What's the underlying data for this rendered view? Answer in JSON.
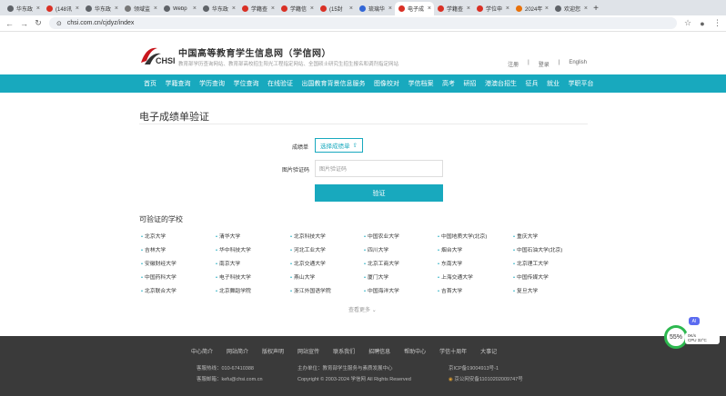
{
  "browser": {
    "tabs": [
      {
        "label": "华东政",
        "color": "#5f6368"
      },
      {
        "label": "(148讯",
        "color": "#d93025"
      },
      {
        "label": "华东政",
        "color": "#5f6368"
      },
      {
        "label": "领域监",
        "color": "#777777"
      },
      {
        "label": "Webp",
        "color": "#5f6368"
      },
      {
        "label": "华东政",
        "color": "#5f6368"
      },
      {
        "label": "学籍查",
        "color": "#d93025"
      },
      {
        "label": "学籍信",
        "color": "#d93025"
      },
      {
        "label": "(15封",
        "color": "#d93025"
      },
      {
        "label": "琉璃华",
        "color": "#3367d6"
      },
      {
        "label": "电子成",
        "color": "#d93025"
      },
      {
        "label": "学籍查",
        "color": "#d93025"
      },
      {
        "label": "学位申",
        "color": "#d93025"
      },
      {
        "label": "2024年",
        "color": "#e8710a"
      },
      {
        "label": "欢迎您",
        "color": "#5f6368"
      }
    ],
    "active_tab": 10,
    "url": "chsi.com.cn/cjdyz/index"
  },
  "header": {
    "site_title": "中国高等教育学生信息网（学信网）",
    "site_subtitle": "教育部学历查询网站、教育部高校招生阳光工程指定网站、全国硕士研究生招生报名和调剂指定网站",
    "logo_text": "CHSI",
    "top_links": [
      "注册",
      "登录",
      "English"
    ]
  },
  "nav": [
    "首页",
    "学籍查询",
    "学历查询",
    "学位查询",
    "在线验证",
    "出国教育背景信息服务",
    "图像校对",
    "学信档案",
    "高考",
    "研招",
    "港澳台招生",
    "征兵",
    "就业",
    "学职平台"
  ],
  "page": {
    "title": "电子成绩单验证",
    "transcript_label": "成绩单",
    "upload_label": "选择成绩单",
    "captcha_label": "图片验证码",
    "captcha_placeholder": "图片验证码",
    "verify_label": "验证",
    "schools_title": "可验证的学校",
    "more_label": "查看更多"
  },
  "schools": [
    [
      "北京大学",
      "清华大学",
      "北京科技大学",
      "中国农业大学",
      "中国地质大学(北京)",
      "重庆大学"
    ],
    [
      "吉林大学",
      "华中科技大学",
      "河北工业大学",
      "四川大学",
      "烟台大学",
      "中国石油大学(北京)"
    ],
    [
      "安徽财经大学",
      "南京大学",
      "北京交通大学",
      "北京工商大学",
      "东南大学",
      "北京理工大学"
    ],
    [
      "中国药科大学",
      "电子科技大学",
      "燕山大学",
      "厦门大学",
      "上海交通大学",
      "中国传媒大学"
    ],
    [
      "北京联合大学",
      "北京舞蹈学院",
      "浙江外国语学院",
      "中国海洋大学",
      "吉首大学",
      "复旦大学"
    ]
  ],
  "footer": {
    "links": [
      "中心简介",
      "网站简介",
      "版权声明",
      "网站宣传",
      "联系我们",
      "招聘信息",
      "帮助中心",
      "学信十周年",
      "大事记"
    ],
    "hotline": "客服热线：010-67410388",
    "email": "客服邮箱：kefu@chsi.com.cn",
    "host": "主办单位：教育部学生服务与素质发展中心",
    "copyright": "Copyright © 2003-2024 学信网 All Rights Reserved",
    "icp": "京ICP备19004913号-1",
    "police": "京公网安备11010202009747号"
  },
  "overlay": {
    "percent": "55%",
    "ai_badge": "AI",
    "net_speed": "0K/s",
    "cpu": "CPU 32°C"
  }
}
